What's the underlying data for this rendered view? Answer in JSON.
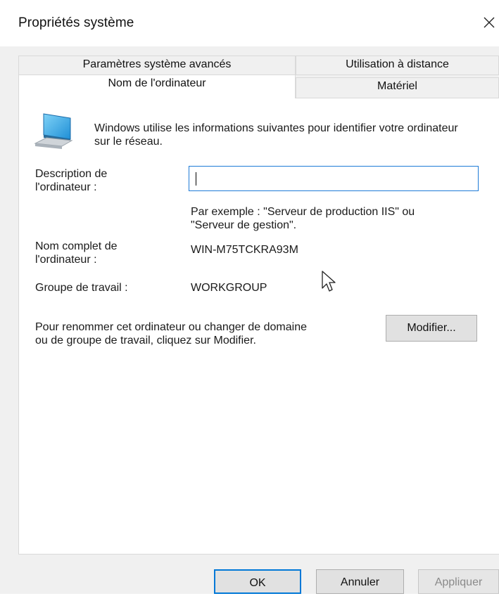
{
  "window": {
    "title": "Propriétés système"
  },
  "tabs": [
    {
      "label": "Paramètres système avancés",
      "active": false
    },
    {
      "label": "Utilisation à distance",
      "active": false
    },
    {
      "label": "Nom de l'ordinateur",
      "active": true
    },
    {
      "label": "Matériel",
      "active": false
    }
  ],
  "panel": {
    "intro": "Windows utilise les informations suivantes pour identifier votre ordinateur sur le réseau.",
    "description_label_line1": "Description de",
    "description_label_line2": "l'ordinateur :",
    "description_value": "",
    "example_line1": "Par exemple : \"Serveur de production IIS\" ou",
    "example_line2": "\"Serveur de gestion\".",
    "full_name_label_line1": "Nom complet de",
    "full_name_label_line2": "l'ordinateur :",
    "full_name_value": "WIN-M75TCKRA93M",
    "workgroup_label": "Groupe de travail :",
    "workgroup_value": "WORKGROUP",
    "rename_text_line1": "Pour renommer cet ordinateur ou changer de domaine",
    "rename_text_line2": "ou de groupe de travail, cliquez sur Modifier.",
    "modify_button": "Modifier..."
  },
  "footer": {
    "ok": "OK",
    "cancel": "Annuler",
    "apply": "Appliquer"
  },
  "colors": {
    "focus_border": "#1e7bd7",
    "dialog_bg": "#f0f0f0",
    "panel_bg": "#ffffff"
  },
  "icons": [
    "close-icon",
    "computer-icon",
    "mouse-cursor-icon"
  ]
}
